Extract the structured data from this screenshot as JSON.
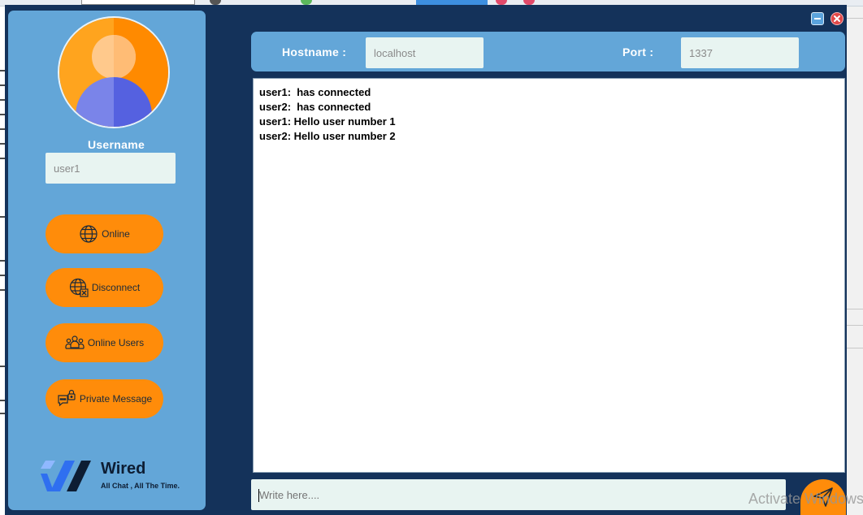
{
  "window": {
    "minimize_icon": "minimize-icon",
    "close_icon": "close-icon",
    "minimize_color": "#5aa3dd",
    "close_color": "#e04848"
  },
  "sidebar": {
    "avatar_icon": "user-avatar-icon",
    "username_label": "Username",
    "username_value": "user1",
    "buttons": {
      "online": {
        "label": "Online",
        "icon": "globe-icon"
      },
      "disconnect": {
        "label": "Disconnect",
        "icon": "globe-x-icon"
      },
      "online_users": {
        "label": "Online Users",
        "icon": "users-group-icon"
      },
      "private_message": {
        "label": "Private Message",
        "icon": "lock-chat-icon"
      }
    },
    "logo": {
      "name": "Wired",
      "tagline": "All Chat , All The Time.",
      "icon": "wired-logo-icon"
    }
  },
  "connection": {
    "hostname_label": "Hostname :",
    "hostname_value": "localhost",
    "port_label": "Port :",
    "port_value": "1337"
  },
  "chat": {
    "messages": [
      "user1:  has connected",
      "user2:  has connected",
      "user1: Hello user number 1",
      "user2: Hello user number 2"
    ]
  },
  "composer": {
    "placeholder": "Write here....",
    "send_icon": "send-icon"
  },
  "watermark": "Activate Windows",
  "colors": {
    "window_bg": "#14325a",
    "panel": "#63a6d8",
    "accent": "#ff8c0a",
    "input_bg": "#e8f4f1"
  }
}
